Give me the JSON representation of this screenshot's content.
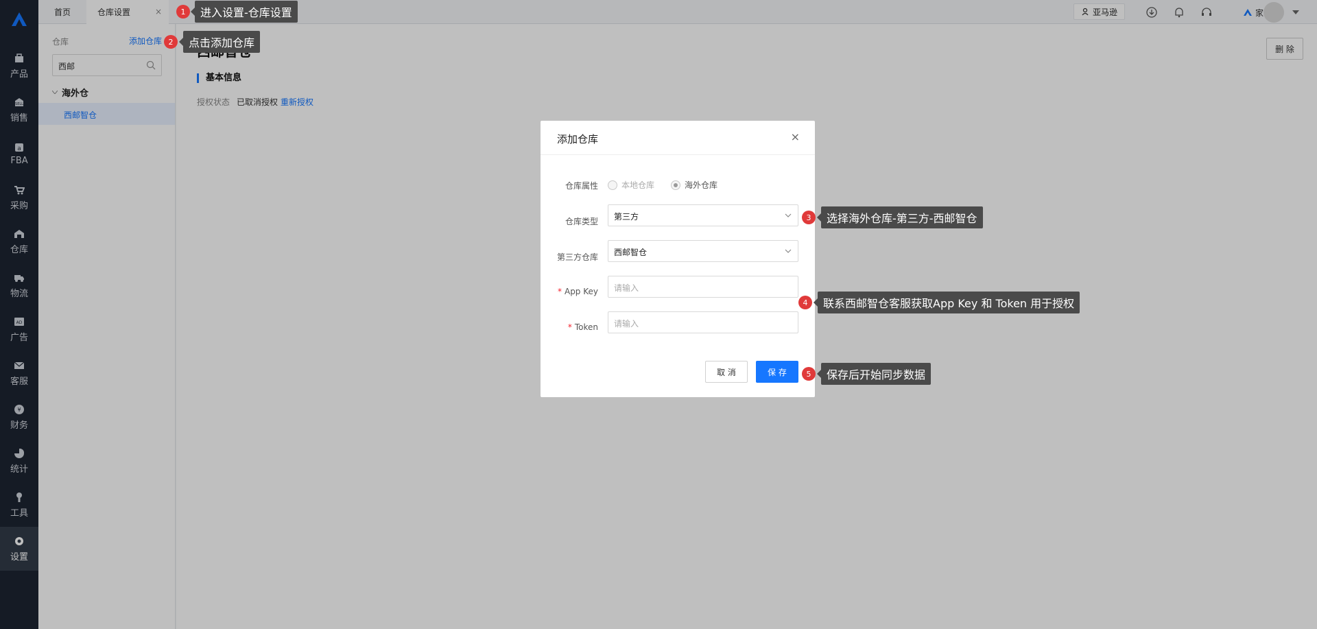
{
  "nav": {
    "items": [
      {
        "label": "产品",
        "icon": "product-icon"
      },
      {
        "label": "销售",
        "icon": "sell-icon"
      },
      {
        "label": "FBA",
        "icon": "fba-icon"
      },
      {
        "label": "采购",
        "icon": "cart-icon"
      },
      {
        "label": "仓库",
        "icon": "warehouse-icon"
      },
      {
        "label": "物流",
        "icon": "truck-icon"
      },
      {
        "label": "广告",
        "icon": "ad-icon"
      },
      {
        "label": "客服",
        "icon": "mail-icon"
      },
      {
        "label": "财务",
        "icon": "finance-icon"
      },
      {
        "label": "统计",
        "icon": "pie-chart-icon"
      },
      {
        "label": "工具",
        "icon": "wrench-icon"
      },
      {
        "label": "设置",
        "icon": "gear-icon"
      }
    ]
  },
  "tabs": [
    {
      "label": "首页"
    },
    {
      "label": "仓库设置",
      "close": "×"
    }
  ],
  "top_right": {
    "store_label": "亚马逊",
    "user_name": "家"
  },
  "sidebar": {
    "section_label": "仓库",
    "add_link": "添加仓库",
    "search_value": "西邮",
    "group_label": "海外仓",
    "selected_item": "西邮智仓"
  },
  "main": {
    "title": "西邮智仓",
    "delete_label": "删 除",
    "section_title": "基本信息",
    "auth_label": "授权状态",
    "auth_value": "已取消授权",
    "reauth_link": "重新授权"
  },
  "modal": {
    "title": "添加仓库",
    "close": "×",
    "attr_label": "仓库属性",
    "radio_local": "本地仓库",
    "radio_overseas": "海外仓库",
    "type_label": "仓库类型",
    "type_value": "第三方",
    "third_label": "第三方仓库",
    "third_value": "西邮智仓",
    "required_mark": "*",
    "appkey_label": "App Key",
    "appkey_placeholder": "请输入",
    "token_label": "Token",
    "token_placeholder": "请输入",
    "cancel": "取 消",
    "save": "保 存"
  },
  "guides": [
    {
      "num": "1",
      "text": "进入设置-仓库设置"
    },
    {
      "num": "2",
      "text": "点击添加仓库"
    },
    {
      "num": "3",
      "text": "选择海外仓库-第三方-西邮智仓"
    },
    {
      "num": "4",
      "text": "联系西邮智仓客服获取App Key 和 Token 用于授权"
    },
    {
      "num": "5",
      "text": "保存后开始同步数据"
    }
  ],
  "colors": {
    "primary": "#1677ff",
    "nav_bg": "#1d2532",
    "badge": "#e03a3a",
    "required": "#f5222d"
  }
}
